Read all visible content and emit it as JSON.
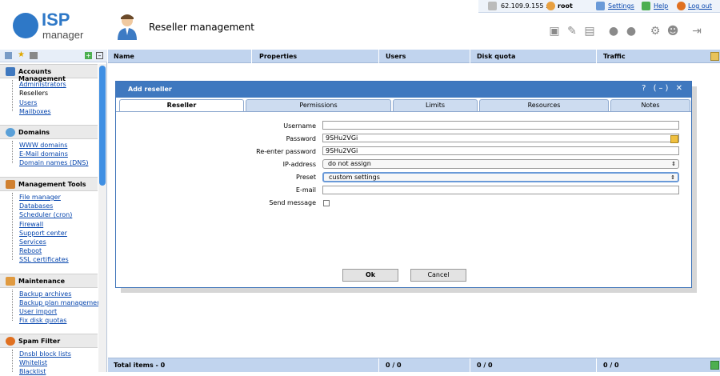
{
  "logo": {
    "name": "ISP",
    "sub": "manager"
  },
  "header": {
    "title": "Reseller management"
  },
  "topbar": {
    "ip": "62.109.9.155 ::",
    "user": "root",
    "settings": "Settings",
    "help": "Help",
    "logout": "Log out"
  },
  "toolbar": {
    "icons": [
      "new-icon",
      "edit-icon",
      "delete-icon",
      "enable-icon",
      "disable-icon",
      "settings-icon",
      "user-icon",
      "export-icon"
    ]
  },
  "sidebar": {
    "sections": [
      {
        "title": "Accounts Management",
        "items": [
          "Administrators",
          "Resellers",
          "Users",
          "Mailboxes"
        ]
      },
      {
        "title": "Domains",
        "items": [
          "WWW domains",
          "E-Mail domains",
          "Domain names (DNS)"
        ]
      },
      {
        "title": "Management Tools",
        "items": [
          "File manager",
          "Databases",
          "Scheduler (cron)",
          "Firewall",
          "Support center",
          "Services",
          "Reboot",
          "SSL certificates"
        ]
      },
      {
        "title": "Maintenance",
        "items": [
          "Backup archives",
          "Backup plan management",
          "User import",
          "Fix disk quotas"
        ]
      },
      {
        "title": "Spam Filter",
        "items": [
          "Dnsbl block lists",
          "Whitelist",
          "Blacklist"
        ]
      }
    ]
  },
  "grid": {
    "columns": [
      "Name",
      "Properties",
      "Users",
      "Disk quota",
      "Traffic"
    ],
    "footer": {
      "total": "Total items - 0",
      "users": "0 / 0",
      "disk": "0 / 0",
      "traffic": "0 / 0"
    }
  },
  "dialog": {
    "title": "Add reseller",
    "controls": "? (–) ✕",
    "tabs": [
      "Reseller",
      "Permissions",
      "Limits",
      "Resources",
      "Notes"
    ],
    "fields": {
      "username_label": "Username",
      "username_value": "",
      "password_label": "Password",
      "password_value": "9SHu2VGi",
      "repassword_label": "Re-enter password",
      "repassword_value": "9SHu2VGi",
      "ip_label": "IP-address",
      "ip_value": "do not assign",
      "preset_label": "Preset",
      "preset_value": "custom settings",
      "email_label": "E-mail",
      "email_value": "",
      "sendmsg_label": "Send message"
    },
    "ok": "Ok",
    "cancel": "Cancel"
  }
}
